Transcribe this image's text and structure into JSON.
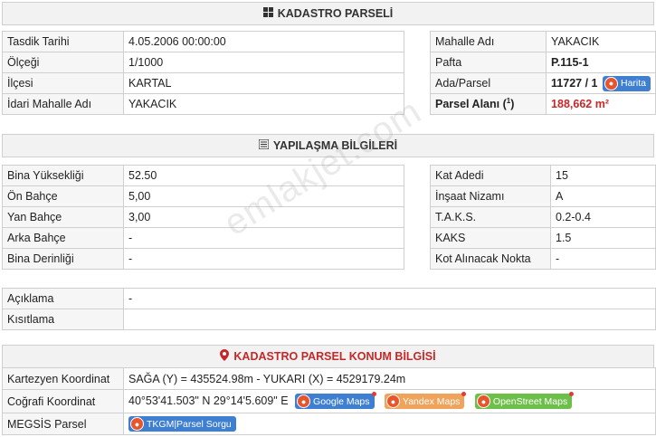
{
  "kadastro": {
    "title": "KADASTRO PARSELİ",
    "left_rows": [
      {
        "label": "Tasdik Tarihi",
        "value": "4.05.2006 00:00:00"
      },
      {
        "label": "Ölçeği",
        "value": "1/1000"
      },
      {
        "label": "İlçesi",
        "value": "KARTAL"
      },
      {
        "label": "İdari Mahalle Adı",
        "value": "YAKACIK"
      }
    ],
    "right_rows": {
      "mahalle": {
        "label": "Mahalle Adı",
        "value": "YAKACIK"
      },
      "pafta": {
        "label": "Pafta",
        "value": "P.115-1"
      },
      "ada": {
        "label": "Ada/Parsel",
        "value": "11727 / 1",
        "button": "Harita"
      },
      "alan": {
        "label": "Parsel Alanı (",
        "sup": "1",
        "label_end": ")",
        "value": "188,662 m²"
      }
    }
  },
  "yapilasma": {
    "title": "YAPILAŞMA BİLGİLERİ",
    "left_rows": [
      {
        "label": "Bina Yüksekliği",
        "value": "52.50"
      },
      {
        "label": "Ön Bahçe",
        "value": "5,00"
      },
      {
        "label": "Yan Bahçe",
        "value": "3,00"
      },
      {
        "label": "Arka Bahçe",
        "value": "-"
      },
      {
        "label": "Bina Derinliği",
        "value": "-"
      }
    ],
    "right_rows": [
      {
        "label": "Kat Adedi",
        "value": "15"
      },
      {
        "label": "İnşaat Nizamı",
        "value": "A"
      },
      {
        "label": "T.A.K.S.",
        "value": "0.2-0.4"
      },
      {
        "label": "KAKS",
        "value": "1.5"
      },
      {
        "label": "Kot Alınacak Nokta",
        "value": "-"
      }
    ]
  },
  "notes": [
    {
      "label": "Açıklama",
      "value": "-"
    },
    {
      "label": "Kısıtlama",
      "value": ""
    }
  ],
  "konum": {
    "title": "KADASTRO PARSEL KONUM BİLGİSİ",
    "kartezyen": {
      "label": "Kartezyen Koordinat",
      "value": "SAĞA (Y) = 435524.98m - YUKARI (X) = 4529179.24m"
    },
    "cografi": {
      "label": "Coğrafi Koordinat",
      "value": "40°53'41.503\" N 29°14'5.609\" E",
      "buttons": [
        "Google Maps",
        "Yandex Maps",
        "OpenStreet Maps"
      ]
    },
    "megsis": {
      "label": "MEGSİS Parsel",
      "button": "TKGM|Parsel Sorgu"
    }
  },
  "watermark": "emlakjet.com",
  "colors": {
    "accent_red": "#c62828",
    "google": "#3f7fd1",
    "yandex": "#f0a35a",
    "osm": "#6cc04a"
  }
}
